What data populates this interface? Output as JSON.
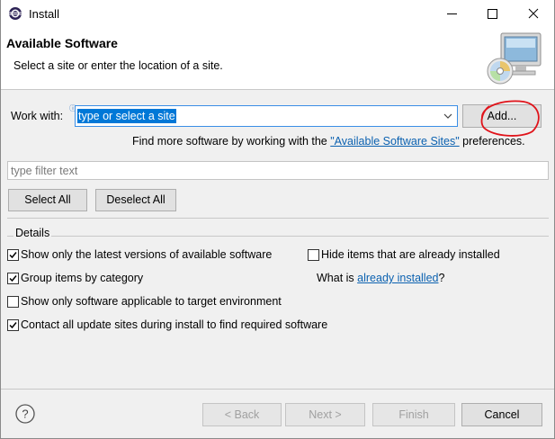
{
  "window": {
    "title": "Install"
  },
  "header": {
    "title": "Available Software",
    "description": "Select a site or enter the location of a site."
  },
  "work_with": {
    "label": "Work with:",
    "value": "type or select a site",
    "add_button": "Add..."
  },
  "more_software": {
    "prefix": "Find more software by working with the ",
    "link": "\"Available Software Sites\"",
    "suffix": " preferences."
  },
  "filter": {
    "placeholder": "type filter text"
  },
  "selection": {
    "select_all": "Select All",
    "deselect_all": "Deselect All"
  },
  "details": {
    "label": "Details",
    "show_latest": {
      "label": "Show only the latest versions of available software",
      "checked": true
    },
    "hide_installed": {
      "label": "Hide items that are already installed",
      "checked": false
    },
    "group_by_category": {
      "label": "Group items by category",
      "checked": true
    },
    "what_is_prefix": "What is ",
    "what_is_link": "already installed",
    "what_is_suffix": "?",
    "show_applicable": {
      "label": "Show only software applicable to target environment",
      "checked": false
    },
    "contact_sites": {
      "label": "Contact all update sites during install to find required software",
      "checked": true
    }
  },
  "footer": {
    "back": "< Back",
    "next": "Next >",
    "finish": "Finish",
    "cancel": "Cancel"
  },
  "colors": {
    "accent": "#0078d7",
    "link": "#0b61b0",
    "annotation": "#e0131a"
  },
  "icons": [
    "eclipse-icon",
    "minimize-icon",
    "maximize-icon",
    "close-icon",
    "monitor-cd-icon",
    "info-icon",
    "chevron-down-icon",
    "help-icon",
    "checkmark-icon"
  ]
}
